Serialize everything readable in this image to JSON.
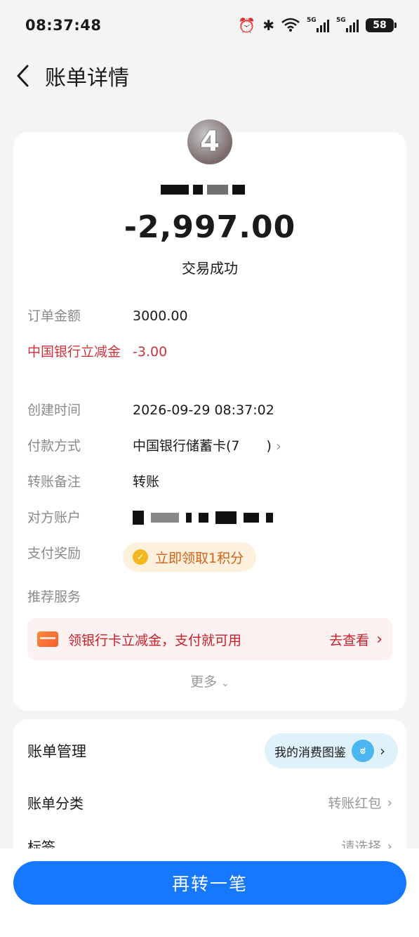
{
  "status_bar": {
    "time": "08:37:48",
    "signal_tag": "5G",
    "battery": "58"
  },
  "header": {
    "title": "账单详情"
  },
  "transaction": {
    "avatar_glyph": "4",
    "amount": "-2,997.00",
    "status": "交易成功"
  },
  "details": {
    "order_amount_label": "订单金额",
    "order_amount_value": "3000.00",
    "discount_label": "中国银行立减金",
    "discount_value": "-3.00",
    "created_label": "创建时间",
    "created_value": "2026-09-29 08:37:02",
    "payment_label": "付款方式",
    "payment_value": "中国银行储蓄卡(7　　)",
    "remark_label": "转账备注",
    "remark_value": "转账",
    "counterparty_label": "对方账户",
    "reward_label": "支付奖励",
    "reward_value": "立即领取1积分",
    "recommend_label": "推荐服务"
  },
  "promo": {
    "text": "领银行卡立减金，支付就可用",
    "link": "去查看"
  },
  "more_label": "更多",
  "bill_management": {
    "title": "账单管理",
    "atlas_label": "我的消费图鉴",
    "category_label": "账单分类",
    "category_value": "转账红包",
    "tag_label": "标签",
    "tag_value": "请选择"
  },
  "cta": {
    "label": "再转一笔"
  },
  "colors": {
    "primary": "#1677ff",
    "alert": "#d0323a",
    "reward": "#d0631a"
  }
}
